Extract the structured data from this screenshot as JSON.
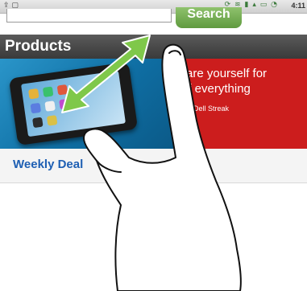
{
  "status_bar": {
    "left_icons": [
      "usb-icon",
      "screenshot-icon"
    ],
    "right_icons": [
      "sync-icon",
      "wifi-icon",
      "sd-card-icon",
      "signal-icon",
      "battery-icon",
      "alarm-icon"
    ],
    "time": "4:11"
  },
  "search": {
    "button_label": "Search"
  },
  "products": {
    "title": "Products"
  },
  "banner": {
    "line1": "are yourself for",
    "line2": "of everything",
    "line3": "the Dell Streak",
    "link": "›"
  },
  "weekly": {
    "title": "Weekly Deal"
  },
  "overlay": {
    "gesture": "pinch-zoom",
    "arrow_color": "#7fc84a",
    "hand_icon": "hand-icon"
  }
}
